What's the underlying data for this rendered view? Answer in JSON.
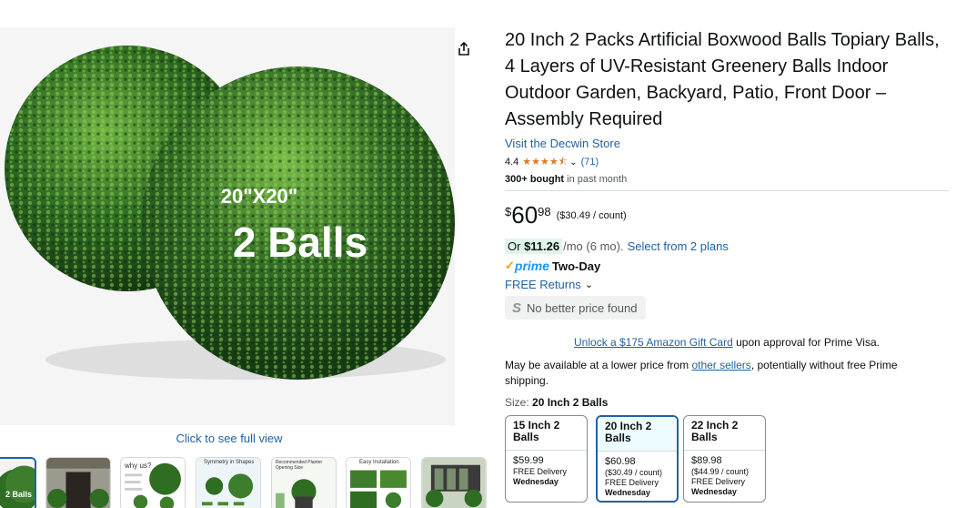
{
  "gallery": {
    "overlay_line1": "20\"X20\"",
    "overlay_line2": "2 Balls",
    "full_view": "Click to see full view",
    "thumbs": [
      {
        "label": "2 Balls"
      },
      {
        "label": ""
      },
      {
        "label": "why us?"
      },
      {
        "label": "Symmetry in Shapes"
      },
      {
        "label": "Recommended Planter Opening Size"
      },
      {
        "label": "Easy Installation"
      },
      {
        "label": ""
      }
    ]
  },
  "product": {
    "title": "20 Inch 2 Packs Artificial Boxwood Balls Topiary Balls, 4 Layers of UV-Resistant Greenery Balls Indoor Outdoor Garden, Backyard, Patio, Front Door – Assembly Required",
    "store_link": "Visit the Decwin Store",
    "rating": "4.4",
    "stars": "★★★★⯪",
    "rating_count": "(71)",
    "bought_bold": "300+ bought",
    "bought_rest": " in past month"
  },
  "price": {
    "currency": "$",
    "whole": "60",
    "fraction": "98",
    "per_unit": "($30.49 / count)",
    "monthly_prefix": "Or ",
    "monthly_amount": "$11.26",
    "monthly_suffix": "/mo (6 mo).",
    "plans_link": "Select from 2 plans",
    "prime_label": "prime",
    "prime_speed": "Two-Day",
    "returns": "FREE Returns",
    "no_better_price": "No better price found"
  },
  "offers": {
    "giftcard_link": "Unlock a $175 Amazon Gift Card",
    "giftcard_rest": " upon approval for Prime Visa.",
    "lower_prefix": "May be available at a lower price from ",
    "lower_link": "other sellers",
    "lower_suffix": ", potentially without free Prime shipping."
  },
  "size": {
    "label": "Size: ",
    "selected": "20 Inch 2 Balls",
    "options": [
      {
        "name": "15 Inch 2 Balls",
        "price": "$59.99",
        "unit": "",
        "delivery": "FREE Delivery",
        "day": "Wednesday"
      },
      {
        "name": "20 Inch 2 Balls",
        "price": "$60.98",
        "unit": "($30.49 / count)",
        "delivery": "FREE Delivery",
        "day": "Wednesday"
      },
      {
        "name": "22 Inch 2 Balls",
        "price": "$89.98",
        "unit": "($44.99 / count)",
        "delivery": "FREE Delivery",
        "day": "Wednesday"
      }
    ]
  },
  "colors": {
    "link": "#2162a1",
    "star": "#de7921",
    "prime_blue": "#1a98ff",
    "prime_check": "#ff9900",
    "foliage_dark": "#1f4f1a",
    "foliage_light": "#5fa83a"
  }
}
